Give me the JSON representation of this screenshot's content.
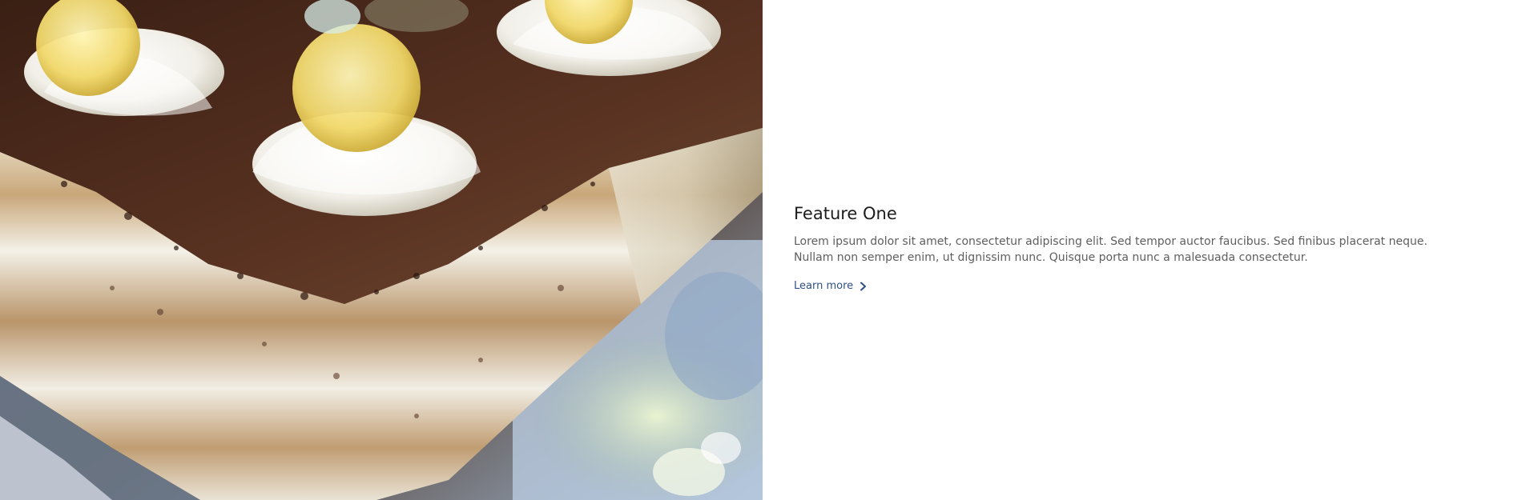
{
  "feature": {
    "title": "Feature One",
    "body": "Lorem ipsum dolor sit amet, consectetur adipiscing elit. Sed tempor auctor faucibus. Sed finibus placerat neque. Nullam non semper enim, ut dignissim nunc. Quisque porta nunc a malesuada consectetur.",
    "link_label": "Learn more",
    "link_icon": "chevron-right-icon",
    "accent_color": "#2f4f8a"
  },
  "image": {
    "subject": "tiramisu-cake-photo"
  }
}
